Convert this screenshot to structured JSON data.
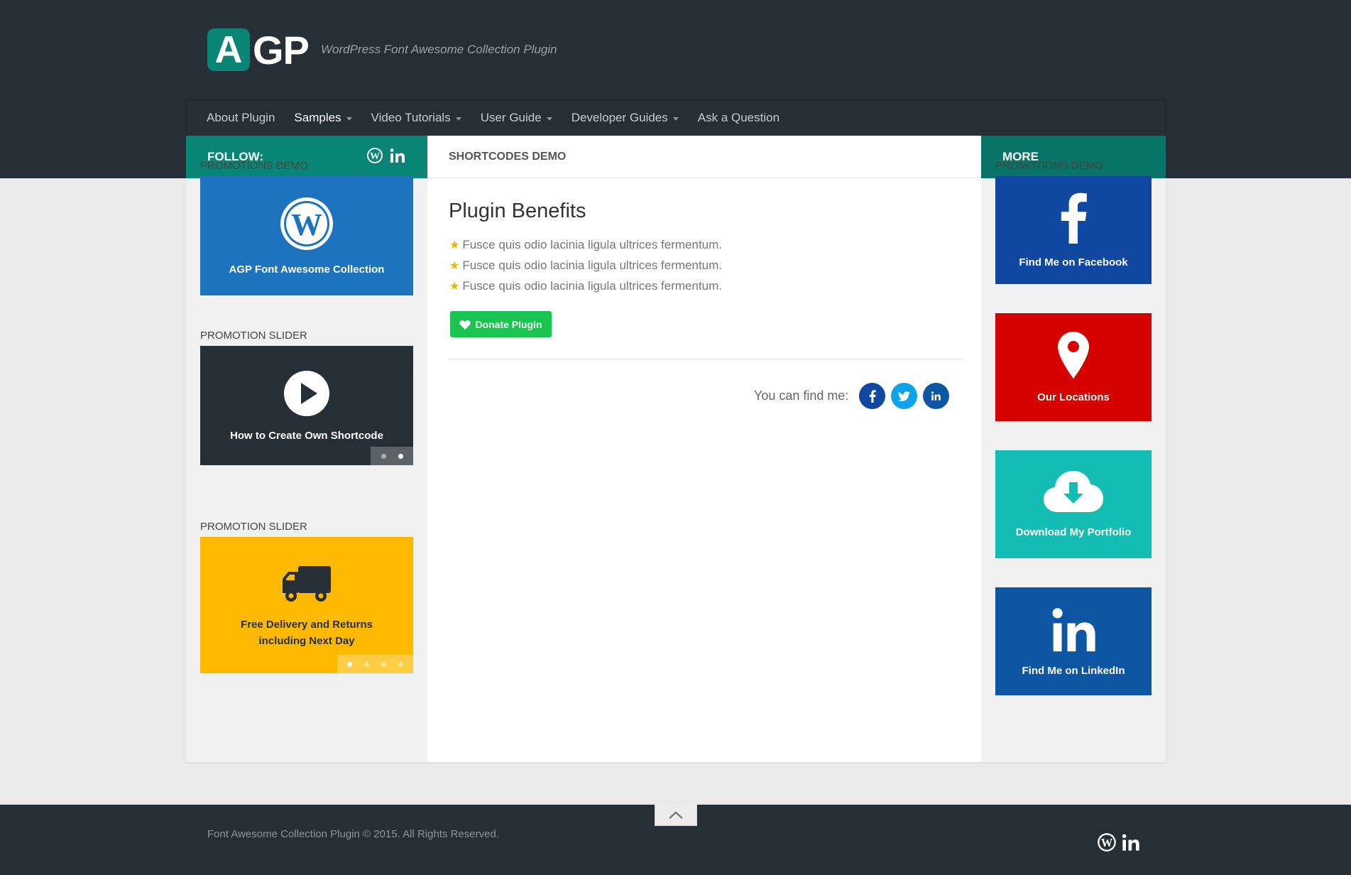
{
  "header": {
    "logo_a": "A",
    "logo_rest": "GP",
    "tagline": "WordPress Font Awesome Collection Plugin"
  },
  "nav": {
    "items": [
      {
        "label": "About Plugin",
        "caret": false
      },
      {
        "label": "Samples",
        "caret": true
      },
      {
        "label": "Video Tutorials",
        "caret": true
      },
      {
        "label": "User Guide",
        "caret": true
      },
      {
        "label": "Developer Guides",
        "caret": true
      },
      {
        "label": "Ask a Question",
        "caret": false
      }
    ]
  },
  "left": {
    "follow_label": "FOLLOW:",
    "widget1": {
      "title": "PROMOTIONS DEMO",
      "label": "AGP Font Awesome Collection",
      "icon": "wordpress-icon",
      "color": "#1d73be"
    },
    "widget2": {
      "title": "PROMOTION SLIDER",
      "label": "How to Create Own Shortcode",
      "icon": "play-circle-icon",
      "color": "#262f36"
    },
    "widget3": {
      "title": "PROMOTION SLIDER",
      "label_line1": "Free Delivery and Returns",
      "label_line2": "including Next Day",
      "icon": "truck-icon",
      "color": "#ffba00"
    }
  },
  "main": {
    "header": "SHORTCODES DEMO",
    "title": "Plugin Benefits",
    "benefits": [
      "Fusce quis odio lacinia ligula ultrices fermentum.",
      "Fusce quis odio lacinia ligula ultrices fermentum.",
      "Fusce quis odio lacinia ligula ultrices fermentum."
    ],
    "donate_label": "Donate Plugin",
    "findme_label": "You can find me:"
  },
  "right": {
    "header": "MORE",
    "title": "PROMOTIONS DEMO",
    "cards": [
      {
        "label": "Find Me on Facebook",
        "icon": "facebook-icon",
        "color": "#0f47a1"
      },
      {
        "label": "Our Locations",
        "icon": "map-marker-icon",
        "color": "#d50000"
      },
      {
        "label": "Download My Portfolio",
        "icon": "cloud-download-icon",
        "color": "#13bdb4"
      },
      {
        "label": "Find Me on LinkedIn",
        "icon": "linkedin-icon",
        "color": "#0d56a4"
      }
    ]
  },
  "footer": {
    "copyright": "Font Awesome Collection Plugin © 2015. All Rights Reserved."
  },
  "colors": {
    "dark": "#262f36",
    "teal": "#098575",
    "green": "#1ac450",
    "facebook": "#0f47a1",
    "twitter": "#0ba4ea",
    "linkedin": "#0d56a4"
  }
}
